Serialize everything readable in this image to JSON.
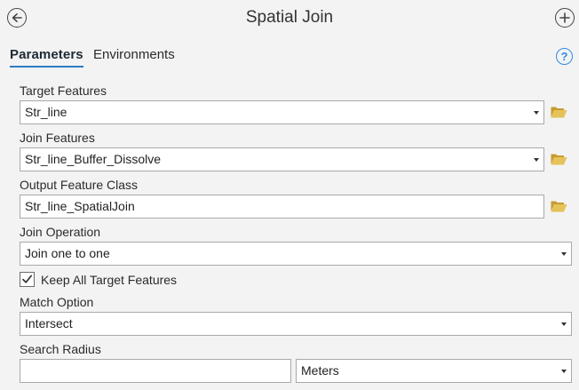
{
  "header": {
    "title": "Spatial Join",
    "back_icon": "back-arrow-icon",
    "add_icon": "add-icon"
  },
  "tabs": [
    {
      "label": "Parameters",
      "active": true
    },
    {
      "label": "Environments",
      "active": false
    }
  ],
  "help": {
    "glyph": "?",
    "icon": "help-icon"
  },
  "form": {
    "target_features": {
      "label": "Target Features",
      "value": "Str_line"
    },
    "join_features": {
      "label": "Join Features",
      "value": "Str_line_Buffer_Dissolve"
    },
    "output_feature_class": {
      "label": "Output Feature Class",
      "value": "Str_line_SpatialJoin"
    },
    "join_operation": {
      "label": "Join Operation",
      "value": "Join one to one"
    },
    "keep_all": {
      "label": "Keep All Target Features",
      "checked": true
    },
    "match_option": {
      "label": "Match Option",
      "value": "Intersect"
    },
    "search_radius": {
      "label": "Search Radius",
      "value": "",
      "unit": "Meters"
    }
  },
  "colors": {
    "accent": "#2d7cc4",
    "folder": "#e0b84a",
    "help": "#2f8be6",
    "background": "#f3f3f3"
  }
}
